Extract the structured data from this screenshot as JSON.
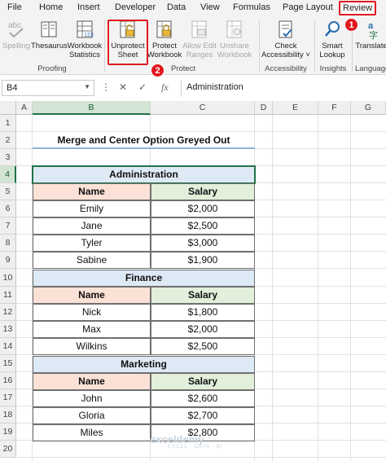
{
  "menu": {
    "tabs": [
      "File",
      "Home",
      "Insert",
      "Developer",
      "Data",
      "View",
      "Formulas",
      "Page Layout",
      "Review"
    ],
    "active_tab": "Review"
  },
  "ribbon": {
    "proofing": {
      "label": "Proofing",
      "buttons": [
        {
          "line1": "Spelling",
          "line2": "",
          "icon": "spelling-abc-icon",
          "enabled": false
        },
        {
          "line1": "Thesaurus",
          "line2": "",
          "icon": "thesaurus-book-icon",
          "enabled": true
        },
        {
          "line1": "Workbook",
          "line2": "Statistics",
          "icon": "workbook-statistics-icon",
          "enabled": true
        }
      ]
    },
    "protect": {
      "label": "Protect",
      "buttons": [
        {
          "line1": "Unprotect",
          "line2": "Sheet",
          "icon": "unprotect-sheet-icon",
          "enabled": true
        },
        {
          "line1": "Protect",
          "line2": "Workbook",
          "icon": "protect-workbook-icon",
          "enabled": true
        },
        {
          "line1": "Allow Edit",
          "line2": "Ranges",
          "icon": "allow-edit-ranges-icon",
          "enabled": false
        },
        {
          "line1": "Unshare",
          "line2": "Workbook",
          "icon": "unshare-workbook-icon",
          "enabled": false
        }
      ]
    },
    "accessibility": {
      "label": "Accessibility",
      "buttons": [
        {
          "line1": "Check",
          "line2": "Accessibility ˅",
          "icon": "check-accessibility-icon",
          "enabled": true
        }
      ]
    },
    "insights": {
      "label": "Insights",
      "buttons": [
        {
          "line1": "Smart",
          "line2": "Lookup",
          "icon": "smart-lookup-icon",
          "enabled": true
        }
      ]
    },
    "language": {
      "label": "Language",
      "buttons": [
        {
          "line1": "Translate",
          "line2": "",
          "icon": "translate-icon",
          "enabled": true
        }
      ]
    },
    "callouts": [
      "1",
      "2"
    ]
  },
  "formula_bar": {
    "name_box": "B4",
    "fx_symbol": "fx",
    "content": "Administration"
  },
  "grid": {
    "columns": [
      "A",
      "B",
      "C",
      "D",
      "E",
      "F",
      "G"
    ],
    "rows": [
      "1",
      "2",
      "3",
      "4",
      "5",
      "6",
      "7",
      "8",
      "9",
      "10",
      "11",
      "12",
      "13",
      "14",
      "15",
      "16",
      "17",
      "18",
      "19",
      "20"
    ],
    "selected_column": "B",
    "selected_row": "4"
  },
  "sheet": {
    "title": "Merge and Center Option Greyed Out",
    "col_name": "Name",
    "col_salary": "Salary",
    "sections": [
      {
        "header": "Administration",
        "rows": [
          {
            "name": "Emily",
            "salary": "$2,000"
          },
          {
            "name": "Jane",
            "salary": "$2,500"
          },
          {
            "name": "Tyler",
            "salary": "$3,000"
          },
          {
            "name": "Sabine",
            "salary": "$1,900"
          }
        ]
      },
      {
        "header": "Finance",
        "rows": [
          {
            "name": "Nick",
            "salary": "$1,800"
          },
          {
            "name": "Max",
            "salary": "$2,000"
          },
          {
            "name": "Wilkins",
            "salary": "$2,500"
          }
        ]
      },
      {
        "header": "Marketing",
        "rows": [
          {
            "name": "John",
            "salary": "$2,600"
          },
          {
            "name": "Gloria",
            "salary": "$2,700"
          },
          {
            "name": "Miles",
            "salary": "$2,800"
          }
        ]
      }
    ]
  },
  "watermark": {
    "brand": "exceldemy",
    "tagline": "EXCEL · DATA · BI"
  },
  "colors": {
    "accent_red": "#e0161e",
    "excel_green": "#217346",
    "header_blue": "#dde9f5",
    "header_peach": "#fbe1d6",
    "header_green": "#e2efda"
  }
}
